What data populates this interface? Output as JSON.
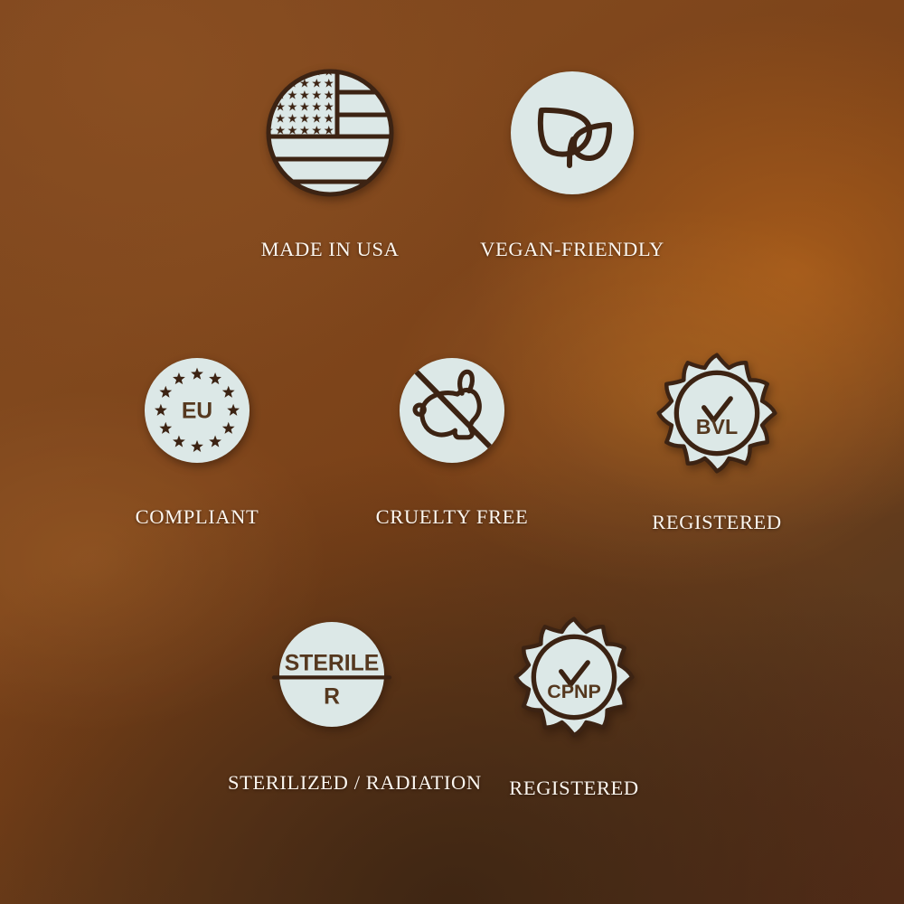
{
  "theme": {
    "background_top_left": "#7c451f",
    "background_top_right": "#733509",
    "background_bottom_left": "#5a3a1c",
    "background_bottom_right": "#56301a",
    "background_highlight": "#a85c1a",
    "badge_fill": "#dce8e7",
    "badge_outline": "#3c2313",
    "badge_glyph": "#55381f",
    "label_color": "#fbf6ef"
  },
  "badges": [
    {
      "id": "made-in-usa",
      "icon": "usa-flag-icon",
      "label": "MADE IN USA",
      "glyph_text": "",
      "row": 1,
      "column": 1
    },
    {
      "id": "vegan-friendly",
      "icon": "leaf-icon",
      "label": "VEGAN-FRIENDLY",
      "glyph_text": "",
      "row": 1,
      "column": 2
    },
    {
      "id": "compliant",
      "icon": "eu-stars-icon",
      "label": "COMPLIANT",
      "glyph_text": "EU",
      "row": 2,
      "column": 1
    },
    {
      "id": "cruelty-free",
      "icon": "no-rabbit-icon",
      "label": "CRUELTY FREE",
      "glyph_text": "",
      "row": 2,
      "column": 2
    },
    {
      "id": "registered-bvl",
      "icon": "bvl-seal-icon",
      "label": "REGISTERED",
      "glyph_text": "BVL",
      "row": 2,
      "column": 3
    },
    {
      "id": "sterilized-radiation",
      "icon": "sterile-r-icon",
      "label": "STERILIZED / RADIATION",
      "glyph_text_top": "STERILE",
      "glyph_text_bottom": "R",
      "row": 3,
      "column": 1
    },
    {
      "id": "registered-cpnp",
      "icon": "cpnp-seal-icon",
      "label": "REGISTERED",
      "glyph_text": "CPNP",
      "row": 3,
      "column": 2
    }
  ]
}
